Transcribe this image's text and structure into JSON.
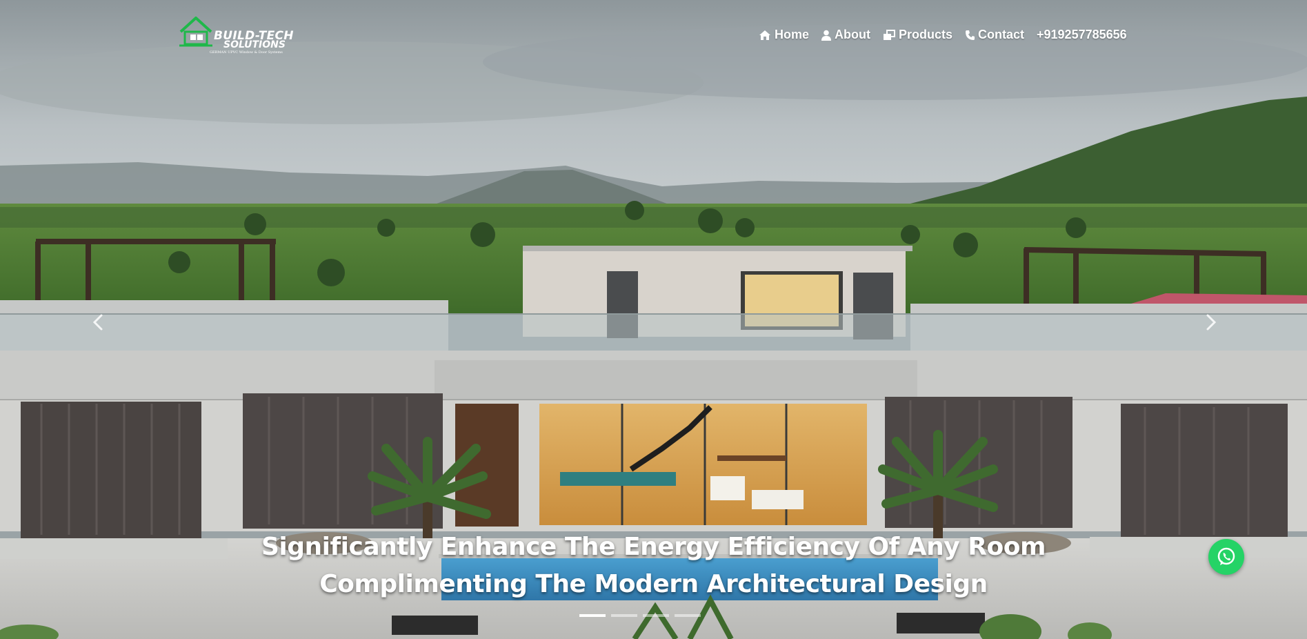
{
  "brand": {
    "name_part1": "BUILD-TECH",
    "name_part2": "SOLUTIONS",
    "tagline": "GERMAN UPVC Window & Door Systems",
    "logo_icon": "house-window-icon",
    "accent_color": "#1fb84a"
  },
  "nav": {
    "items": [
      {
        "label": "Home",
        "icon": "home-icon"
      },
      {
        "label": "About",
        "icon": "user-icon"
      },
      {
        "label": "Products",
        "icon": "products-icon"
      },
      {
        "label": "Contact",
        "icon": "phone-icon"
      },
      {
        "label": "+919257785656",
        "icon": ""
      }
    ]
  },
  "hero": {
    "caption_line1": "Significantly Enhance The Energy Efficiency Of Any Room",
    "caption_line2": "Complimenting The Modern Architectural Design",
    "slide_count": 4,
    "active_slide": 1
  },
  "whatsapp": {
    "icon": "whatsapp-icon",
    "color": "#25d366"
  }
}
